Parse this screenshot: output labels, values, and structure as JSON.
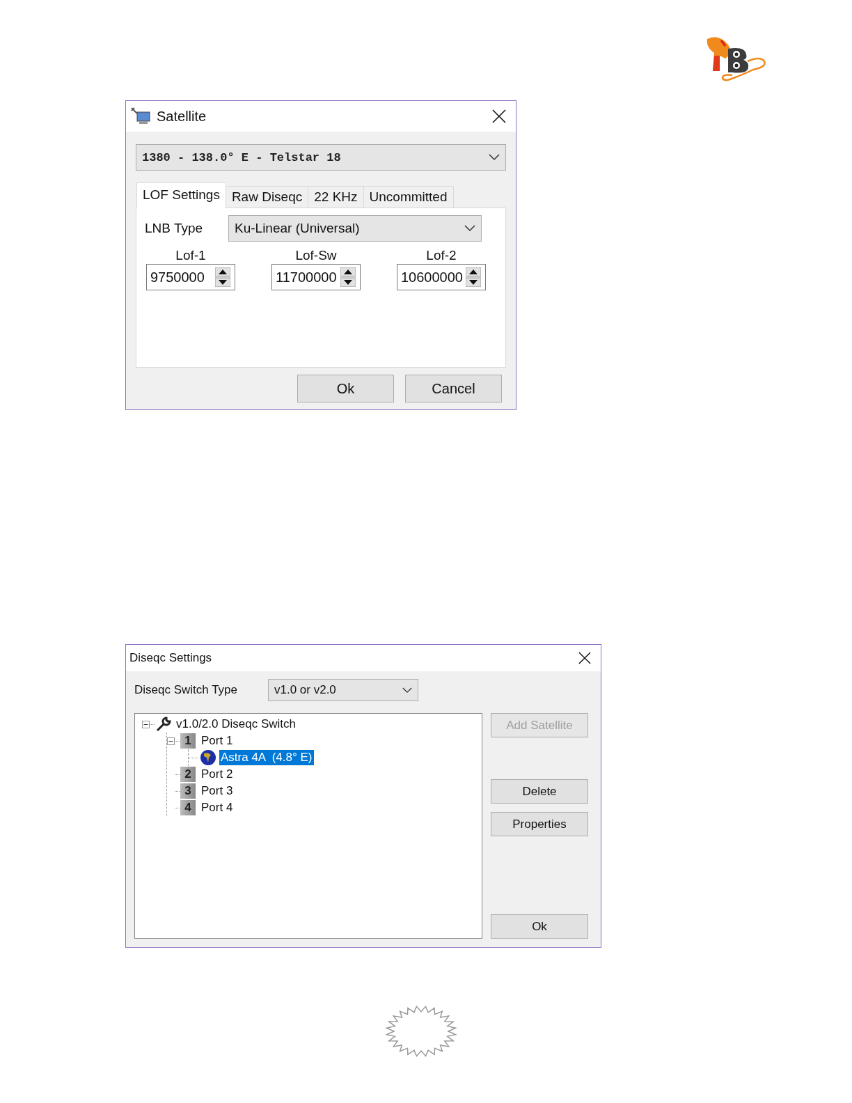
{
  "satellite_dialog": {
    "title": "Satellite",
    "satellite_select": {
      "value": "1380 - 138.0° E - Telstar 18"
    },
    "tabs": [
      {
        "label": "LOF Settings",
        "selected": true
      },
      {
        "label": "Raw Diseqc",
        "selected": false
      },
      {
        "label": "22 KHz",
        "selected": false
      },
      {
        "label": "Uncommitted",
        "selected": false
      }
    ],
    "lnb_type": {
      "label": "LNB Type",
      "value": "Ku-Linear (Universal)"
    },
    "lof_fields": [
      {
        "label": "Lof-1",
        "value": "9750000"
      },
      {
        "label": "Lof-Sw",
        "value": "11700000"
      },
      {
        "label": "Lof-2",
        "value": "10600000"
      }
    ],
    "buttons": [
      {
        "label": "Ok",
        "disabled": false
      },
      {
        "label": "Cancel",
        "disabled": false
      }
    ]
  },
  "diseqc_dialog": {
    "title": "Diseqc Settings",
    "switch_type": {
      "label": "Diseqc Switch Type",
      "value": "v1.0 or v2.0"
    },
    "tree": [
      {
        "label": "v1.0/2.0 Diseqc Switch",
        "expanded": true,
        "selected": false,
        "children": [
          {
            "number": "1",
            "label": "Port 1",
            "expanded": true,
            "selected": false,
            "children": [
              {
                "label": "Astra 4A  (4.8° E)",
                "selected": true
              }
            ]
          },
          {
            "number": "2",
            "label": "Port 2",
            "selected": false
          },
          {
            "number": "3",
            "label": "Port 3",
            "selected": false
          },
          {
            "number": "4",
            "label": "Port 4",
            "selected": false
          }
        ]
      }
    ],
    "buttons": [
      {
        "label": "Add Satellite",
        "disabled": true
      },
      {
        "label": "Delete",
        "disabled": false
      },
      {
        "label": "Properties",
        "disabled": false
      },
      {
        "label": "Ok",
        "disabled": false
      }
    ]
  }
}
